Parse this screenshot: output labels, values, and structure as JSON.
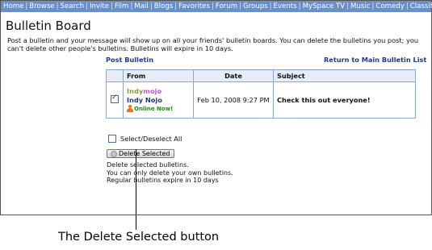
{
  "nav": {
    "items": [
      "Home",
      "Browse",
      "Search",
      "Invite",
      "Film",
      "Mail",
      "Blogs",
      "Favorites",
      "Forum",
      "Groups",
      "Events",
      "MySpace TV",
      "Music",
      "Comedy",
      "Classifieds"
    ]
  },
  "page": {
    "title": "Bulletin Board",
    "description": "Post a bulletin and your message will show up on all your friends' bulletin boards. You can delete the bulletins you post; you can't delete other people's bulletins. Bulletins will expire in 10 days.",
    "post_link": "Post Bulletin",
    "return_link": "Return to Main Bulletin List"
  },
  "table": {
    "headers": {
      "from": "From",
      "date": "Date",
      "subject": "Subject"
    },
    "rows": [
      {
        "checked": true,
        "logo_text_a": "Indy",
        "logo_text_b": "mojo",
        "name": "Indy Nojo",
        "status": "Online Now!",
        "date": "Feb 10, 2008 9:27 PM",
        "subject": "Check this out everyone!"
      }
    ]
  },
  "controls": {
    "select_all_label": "Select/Deselect All",
    "delete_button_label": "Delete Selected"
  },
  "notes": {
    "line1": "Delete selected bulletins.",
    "line2": "You can only delete your own bulletins.",
    "line3": "Regular bulletins expire in 10 days"
  },
  "annotation": {
    "label": "The Delete Selected button"
  }
}
